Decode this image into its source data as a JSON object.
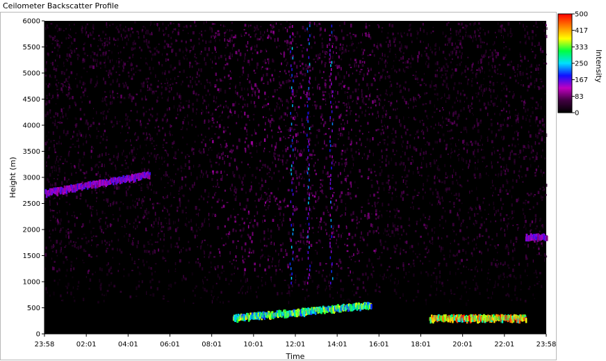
{
  "window": {
    "title": "Ceilometer Backscatter Profile"
  },
  "chart_data": {
    "type": "heatmap",
    "title": "",
    "xlabel": "Time",
    "ylabel": "Height (m)",
    "x_ticks": [
      "23:58",
      "02:01",
      "04:01",
      "06:01",
      "08:01",
      "10:01",
      "12:01",
      "14:01",
      "16:01",
      "18:01",
      "20:01",
      "22:01",
      "23:58"
    ],
    "y_ticks": [
      0,
      500,
      1000,
      1500,
      2000,
      2500,
      3000,
      3500,
      4000,
      4500,
      5000,
      5500,
      6000
    ],
    "ylim": [
      0,
      6000
    ],
    "colorbar": {
      "label": "Intensity",
      "ticks": [
        0,
        83,
        167,
        250,
        333,
        417,
        500
      ],
      "range": [
        0,
        500
      ],
      "colors": [
        "#000000",
        "#400040",
        "#c000c0",
        "#1010ff",
        "#00e0ff",
        "#00ff40",
        "#ffff00",
        "#ff8000",
        "#ff0000"
      ]
    },
    "features": [
      {
        "name": "low cloud layer morning",
        "x_start_h": 9.0,
        "x_end_h": 15.6,
        "height_start": 300,
        "height_end": 550,
        "intensity": 320
      },
      {
        "name": "low cloud layer evening",
        "x_start_h": 18.4,
        "x_end_h": 23.0,
        "height": 300,
        "intensity": 420
      },
      {
        "name": "early cloud trace",
        "x_start_h": 0.0,
        "x_end_h": 5.0,
        "height_start": 2700,
        "height_end": 3050,
        "intensity": 150
      },
      {
        "name": "late cloud trace",
        "x_start_h": 23.0,
        "x_end_h": 24.0,
        "height": 1850,
        "intensity": 150
      }
    ]
  }
}
